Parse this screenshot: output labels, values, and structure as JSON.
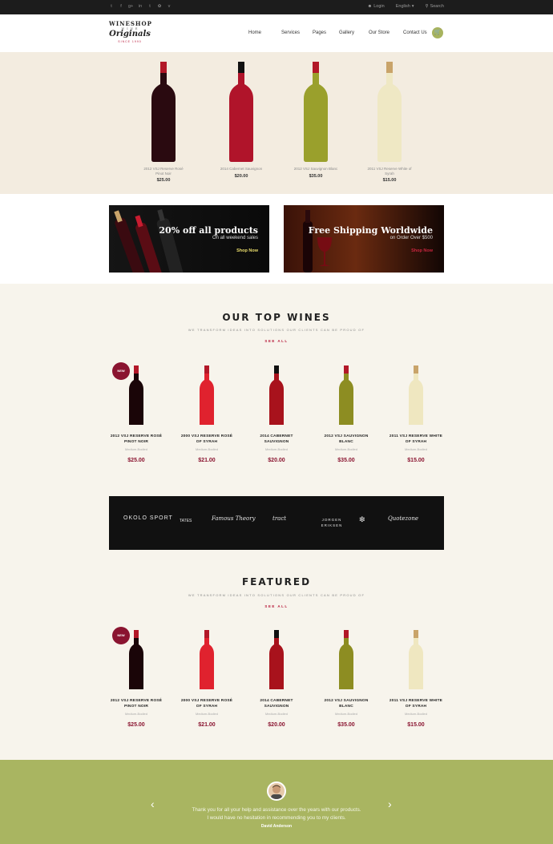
{
  "topbar": {
    "social_icons": [
      "twitter-icon",
      "facebook-icon",
      "google-plus-icon",
      "linkedin-icon",
      "tumblr-icon",
      "flickr-icon",
      "vimeo-icon"
    ],
    "social_glyphs": [
      "t",
      "f",
      "g+",
      "in",
      "t",
      "✿",
      "v"
    ],
    "login": "Login",
    "language": "English",
    "search": "Search"
  },
  "header": {
    "logo": {
      "line1": "WINESHOP",
      "line2": "W I N E",
      "line3": "Originals",
      "line4": "SINCE 1990"
    },
    "nav": [
      "Home",
      "Services",
      "Pages",
      "Gallery",
      "Our Store",
      "Contact Us"
    ],
    "cart_icon": "cart-icon"
  },
  "hero_products": [
    {
      "name": "2012 VSJ Reserve Rosé Pinot Noir",
      "price": "$25.00",
      "color": "#2a0a10"
    },
    {
      "name": "2014 Cabernet Sauvignon",
      "price": "$20.00",
      "color": "#b0142a"
    },
    {
      "name": "2012 VSJ Sauvignon Blanc",
      "price": "$35.00",
      "color": "#9aa02c"
    },
    {
      "name": "2011 VSJ Reserve White of Syrah",
      "price": "$15.00",
      "color": "#efe8c4"
    }
  ],
  "banners": [
    {
      "title": "20% off all products",
      "subtitle": "On all weekend sales",
      "cta": "Shop Now",
      "cta_color": "#e9dc6b"
    },
    {
      "title": "Free Shipping Worldwide",
      "subtitle": "on Order Over $500",
      "cta": "Shop Now",
      "cta_color": "#c8253e"
    }
  ],
  "top_wines": {
    "title": "OUR TOP WINES",
    "subtitle": "WE TRANSFORM IDEAS INTO SOLUTIONS OUR CLIENTS CAN BE PROUD OF",
    "see_all": "SEE ALL",
    "products": [
      {
        "badge": "NEW",
        "name_line1": "2012 VSJ RESERVE ROSÉ",
        "name_line2": "PINOT NOIR",
        "type": "Medium-Bodied",
        "price": "$25.00",
        "color": "#1a0508"
      },
      {
        "badge": "",
        "name_line1": "2000 VSJ RESERVE ROSÉ",
        "name_line2": "OF SYRAH",
        "type": "Medium-Bodied",
        "price": "$21.00",
        "color": "#e0222e"
      },
      {
        "badge": "",
        "name_line1": "2014 CABERNET",
        "name_line2": "SAUVIGNON",
        "type": "Medium-Bodied",
        "price": "$20.00",
        "color": "#a8121c"
      },
      {
        "badge": "",
        "name_line1": "2012 VSJ SAUVIGNON",
        "name_line2": "BLANC",
        "type": "Medium-Bodied",
        "price": "$35.00",
        "color": "#8d8d22"
      },
      {
        "badge": "",
        "name_line1": "2011 VSJ RESERVE WHITE",
        "name_line2": "OF SYRAH",
        "type": "Medium-Bodied",
        "price": "$15.00",
        "color": "#efe7c0"
      }
    ]
  },
  "brands": [
    "OKOLO SPORT",
    "TATES",
    "Famous Theory",
    "tract",
    "JORGEN ERIKSEN",
    "stag",
    "Quotezone"
  ],
  "featured": {
    "title": "FEATURED",
    "subtitle": "WE TRANSFORM IDEAS INTO SOLUTIONS OUR CLIENTS CAN BE PROUD OF",
    "see_all": "SEE ALL",
    "products": [
      {
        "badge": "NEW",
        "name_line1": "2012 VSJ RESERVE ROSÉ",
        "name_line2": "PINOT NOIR",
        "type": "Medium-Bodied",
        "price": "$25.00",
        "color": "#1a0508"
      },
      {
        "badge": "",
        "name_line1": "2000 VSJ RESERVE ROSÉ",
        "name_line2": "OF SYRAH",
        "type": "Medium-Bodied",
        "price": "$21.00",
        "color": "#e0222e"
      },
      {
        "badge": "",
        "name_line1": "2014 CABERNET",
        "name_line2": "SAUVIGNON",
        "type": "Medium-Bodied",
        "price": "$20.00",
        "color": "#a8121c"
      },
      {
        "badge": "",
        "name_line1": "2012 VSJ SAUVIGNON",
        "name_line2": "BLANC",
        "type": "Medium-Bodied",
        "price": "$35.00",
        "color": "#8d8d22"
      },
      {
        "badge": "",
        "name_line1": "2011 VSJ RESERVE WHITE",
        "name_line2": "OF SYRAH",
        "type": "Medium-Bodied",
        "price": "$15.00",
        "color": "#efe7c0"
      }
    ]
  },
  "testimonial": {
    "line1": "Thank you for all your help and assistance over the years with our products.",
    "line2": "I would have no hesitation in recommending you to my clients.",
    "author": "David Anderson"
  }
}
